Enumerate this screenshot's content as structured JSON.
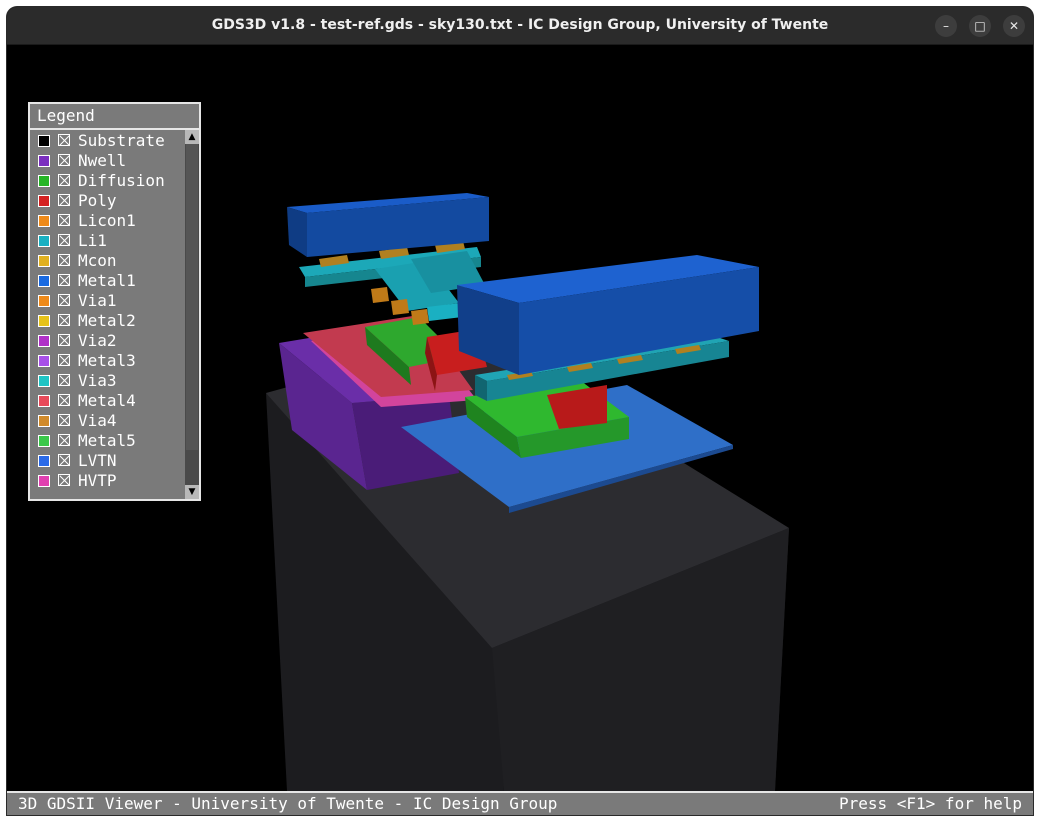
{
  "window": {
    "title": "GDS3D v1.8 - test-ref.gds - sky130.txt - IC Design Group, University of Twente",
    "controls": {
      "minimize": "–",
      "maximize": "□",
      "close": "✕"
    }
  },
  "legend": {
    "title": "Legend",
    "items": [
      {
        "label": "Substrate",
        "color": "#000000"
      },
      {
        "label": "Nwell",
        "color": "#7b2fbf"
      },
      {
        "label": "Diffusion",
        "color": "#26b526"
      },
      {
        "label": "Poly",
        "color": "#d42222"
      },
      {
        "label": "Licon1",
        "color": "#ee8a1a"
      },
      {
        "label": "Li1",
        "color": "#1ab0c2"
      },
      {
        "label": "Mcon",
        "color": "#e0b020"
      },
      {
        "label": "Metal1",
        "color": "#1a6ae0"
      },
      {
        "label": "Via1",
        "color": "#ee8a1a"
      },
      {
        "label": "Metal2",
        "color": "#e6c21a"
      },
      {
        "label": "Via2",
        "color": "#b030c8"
      },
      {
        "label": "Metal3",
        "color": "#a850e8"
      },
      {
        "label": "Via3",
        "color": "#20c4c4"
      },
      {
        "label": "Metal4",
        "color": "#e84a5a"
      },
      {
        "label": "Via4",
        "color": "#d08a2a"
      },
      {
        "label": "Metal5",
        "color": "#3ac84a"
      },
      {
        "label": "LVTN",
        "color": "#2a6ae8"
      },
      {
        "label": "HVTP",
        "color": "#e040b0"
      }
    ],
    "scroll_up": "▲",
    "scroll_down": "▼"
  },
  "status": {
    "left": "3D GDSII Viewer - University of Twente - IC Design Group",
    "right": "Press <F1> for help"
  }
}
